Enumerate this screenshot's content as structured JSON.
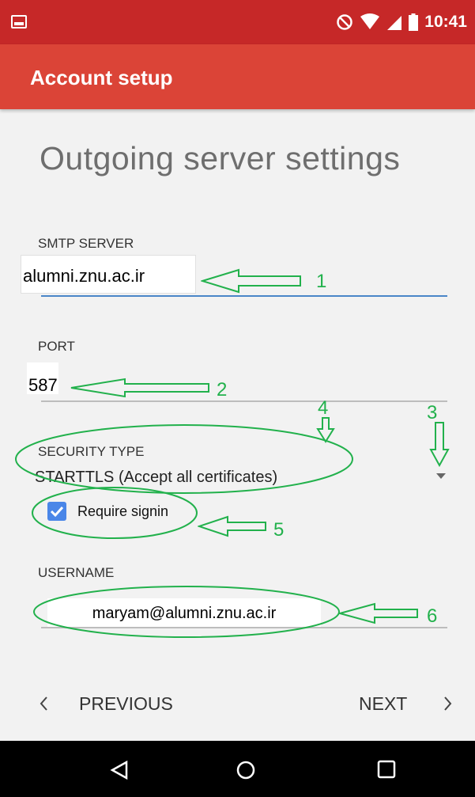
{
  "status_bar": {
    "time": "10:41",
    "icons": [
      "image-icon",
      "do-not-disturb-icon",
      "wifi-icon",
      "signal-icon",
      "battery-icon"
    ]
  },
  "app_bar": {
    "title": "Account setup"
  },
  "page_title": "Outgoing server settings",
  "smtp": {
    "label": "SMTP SERVER",
    "value": "alumni.znu.ac.ir"
  },
  "port": {
    "label": "PORT",
    "value": "587"
  },
  "security": {
    "label": "SECURITY TYPE",
    "value": "STARTTLS (Accept all certificates)"
  },
  "require_signin": {
    "label": "Require signin",
    "checked": true
  },
  "username": {
    "label": "USERNAME",
    "value": "maryam@alumni.znu.ac.ir"
  },
  "nav": {
    "previous": "PREVIOUS",
    "next": "NEXT"
  },
  "annotations": {
    "a1": "1",
    "a2": "2",
    "a3": "3",
    "a4": "4",
    "a5": "5",
    "a6": "6"
  },
  "colors": {
    "status_bar": "#c62828",
    "app_bar": "#db4437",
    "accent": "#4a86c8",
    "annotation": "#22b14c"
  }
}
